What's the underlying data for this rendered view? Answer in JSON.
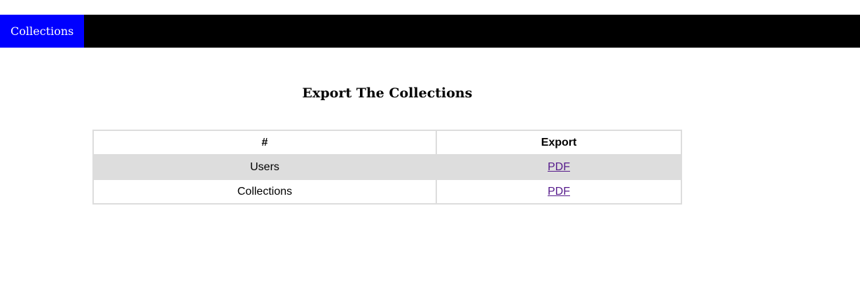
{
  "navbar": {
    "items": [
      {
        "label": "Collections"
      }
    ]
  },
  "main": {
    "heading": "Export The Collections",
    "table": {
      "headers": [
        "#",
        "Export"
      ],
      "rows": [
        {
          "name": "Users",
          "link": "PDF"
        },
        {
          "name": "Collections",
          "link": "PDF"
        }
      ]
    }
  },
  "colors": {
    "navbar_bg": "#000000",
    "nav_active_bg": "#0000ff",
    "row_shade": "#dddddd",
    "link": "#551a8b"
  }
}
